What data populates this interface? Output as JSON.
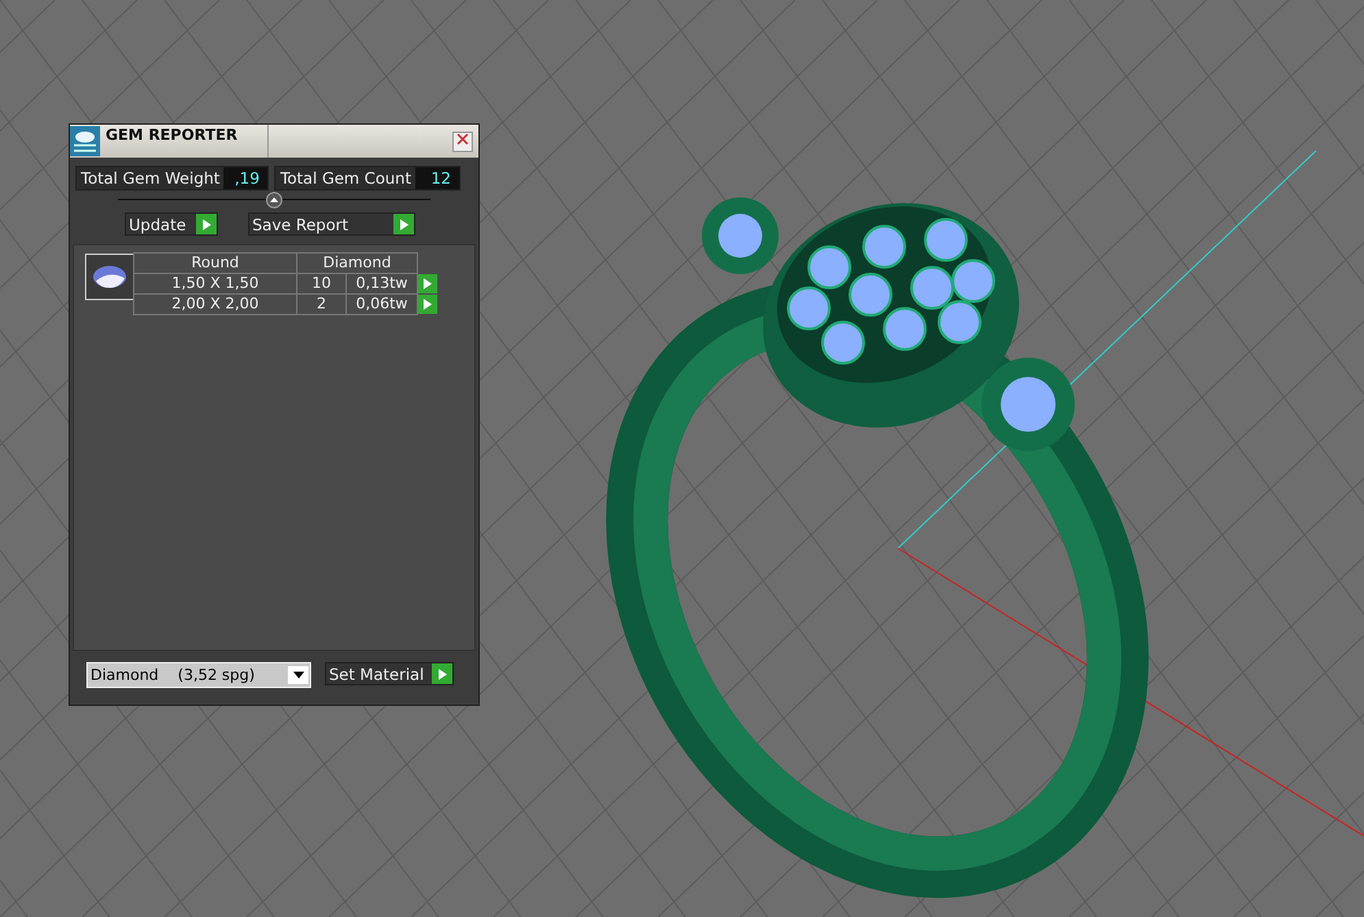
{
  "panel": {
    "title": "GEM REPORTER",
    "stats": [
      {
        "label": "Total Gem Weight",
        "value": ",19"
      },
      {
        "label": "Total Gem Count",
        "value": "12"
      }
    ],
    "actions": [
      "Update",
      "Save Report"
    ],
    "table": {
      "columns": [
        "Round",
        "Diamond"
      ],
      "rows": [
        {
          "size": "1,50 X 1,50",
          "count": "10",
          "weight": "0,13tw"
        },
        {
          "size": "2,00 X 2,00",
          "count": "2",
          "weight": "0,06tw"
        }
      ]
    },
    "material": {
      "value": "Diamond    (3,52 spg)",
      "button": "Set Material"
    }
  }
}
